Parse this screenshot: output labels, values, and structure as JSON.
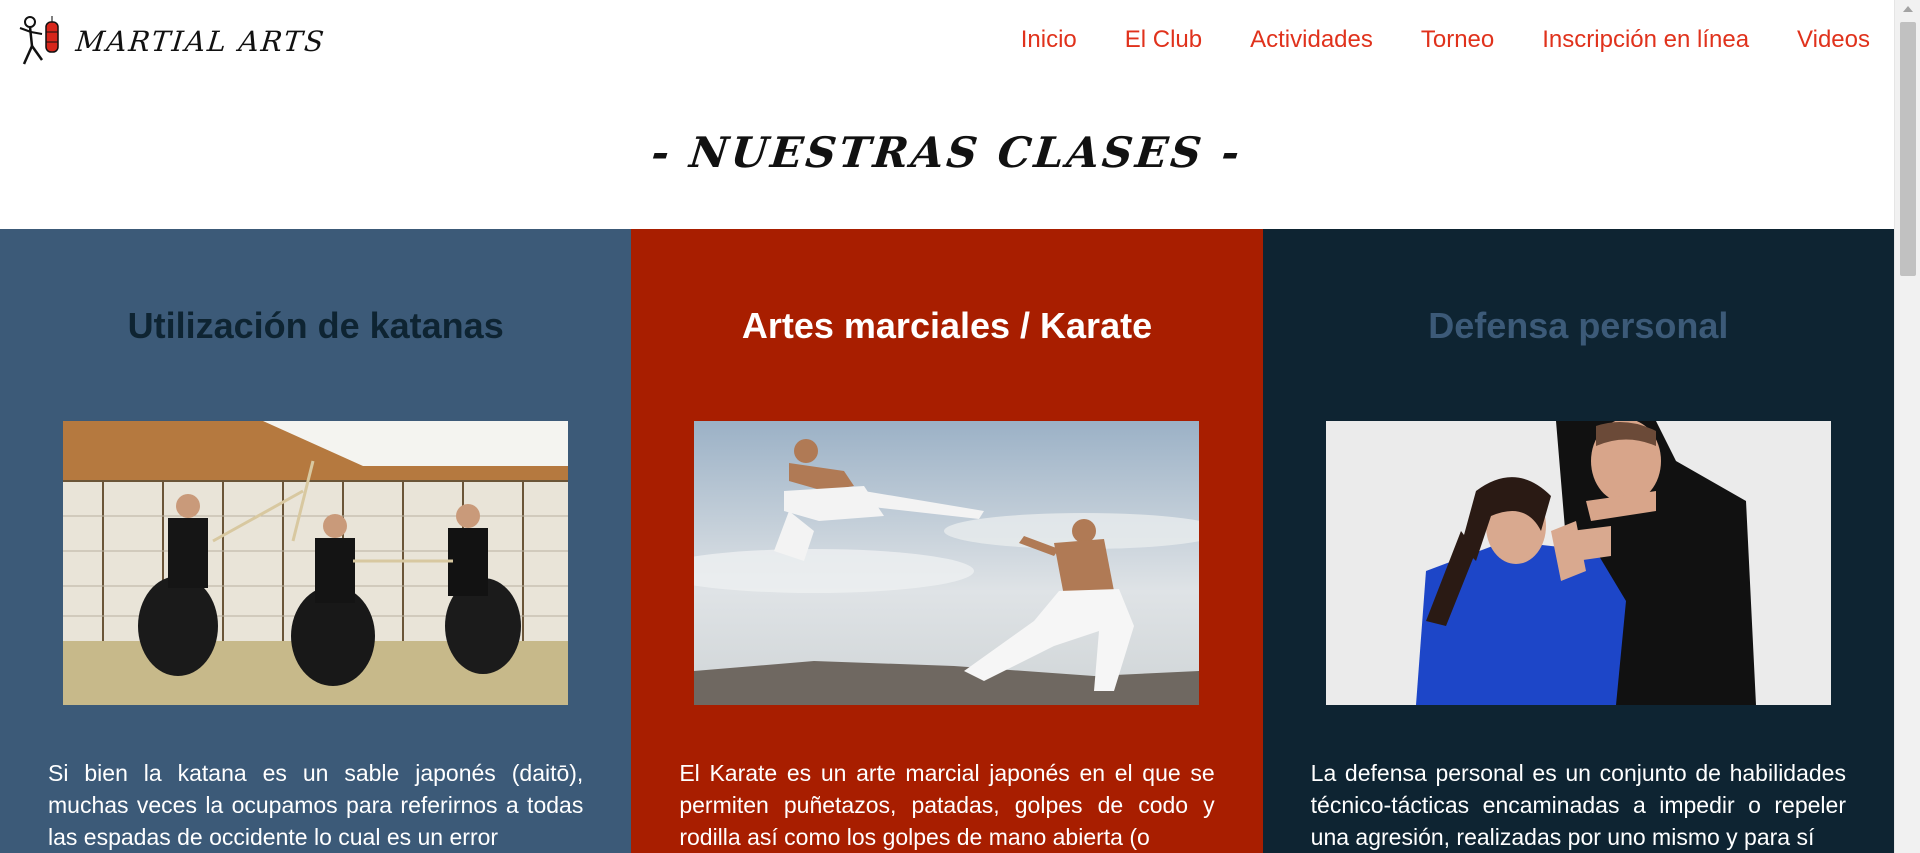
{
  "header": {
    "logo_text": "MARTIAL ARTS",
    "nav": [
      "Inicio",
      "El Club",
      "Actividades",
      "Torneo",
      "Inscripción en línea",
      "Videos"
    ]
  },
  "section": {
    "title": "- NUESTRAS CLASES -"
  },
  "classes": [
    {
      "title": "Utilización de katanas",
      "text": "Si bien la katana es un sable japonés (daitō), muchas veces la ocupamos para referirnos a todas las espadas de occidente lo cual es un error",
      "bg_color": "#3c5a78",
      "image": "katana-dojo-photo"
    },
    {
      "title": "Artes marciales / Karate",
      "text": "El Karate es un arte marcial japonés en el que se permiten puñetazos, patadas, golpes de codo y rodilla así como los golpes de mano abierta (o",
      "bg_color": "#a81e00",
      "image": "karate-jump-kick-photo"
    },
    {
      "title": "Defensa personal",
      "text": "La defensa personal es un conjunto de habilidades técnico-tácticas encaminadas a impedir o repeler una agresión, realizadas por uno mismo y para sí",
      "bg_color": "#0e2432",
      "image": "self-defense-photo"
    }
  ],
  "colors": {
    "nav_link": "#e0321c",
    "accent_red": "#a81e00",
    "slate_blue": "#3c5a78",
    "dark_navy": "#0e2432"
  }
}
